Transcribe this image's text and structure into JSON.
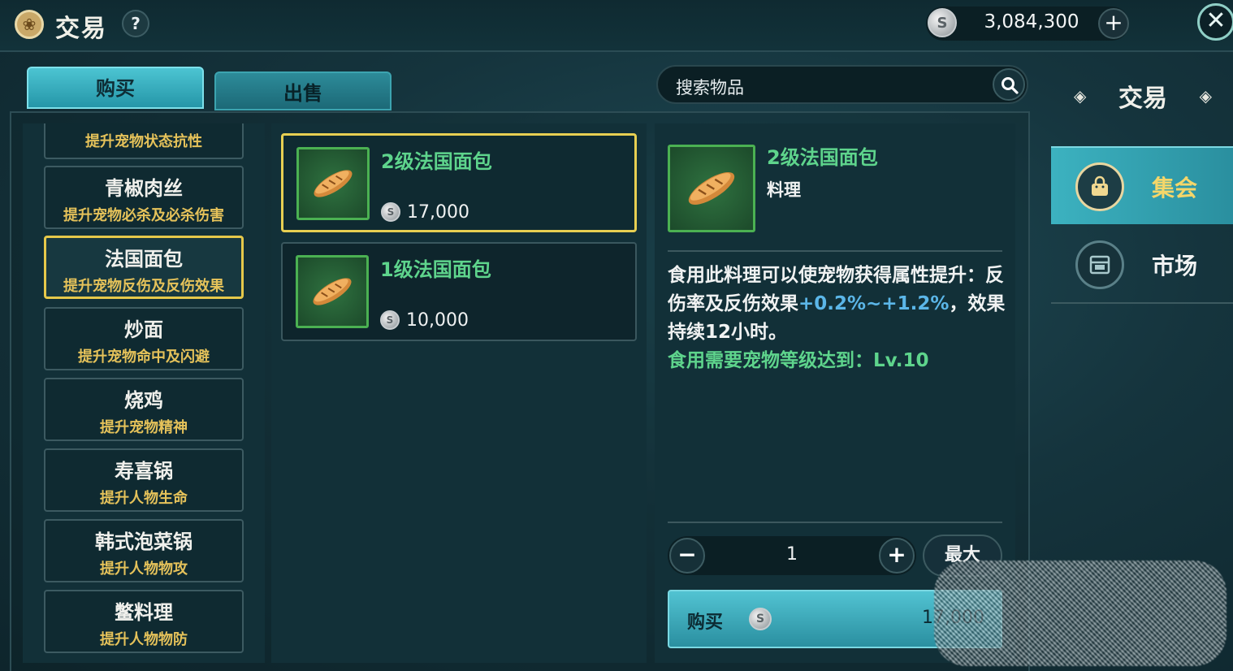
{
  "header": {
    "title": "交易",
    "help_label": "?",
    "currency_value": "3,084,300",
    "add_label": "+",
    "close_label": "✕"
  },
  "tabs": {
    "buy": "购买",
    "sell": "出售"
  },
  "search": {
    "placeholder": "搜索物品"
  },
  "categories": [
    {
      "name": "",
      "desc": "提升宠物状态抗性",
      "partial": true
    },
    {
      "name": "青椒肉丝",
      "desc": "提升宠物必杀及必杀伤害"
    },
    {
      "name": "法国面包",
      "desc": "提升宠物反伤及反伤效果",
      "selected": true
    },
    {
      "name": "炒面",
      "desc": "提升宠物命中及闪避"
    },
    {
      "name": "烧鸡",
      "desc": "提升宠物精神"
    },
    {
      "name": "寿喜锅",
      "desc": "提升人物生命"
    },
    {
      "name": "韩式泡菜锅",
      "desc": "提升人物物攻"
    },
    {
      "name": "鳖料理",
      "desc": "提升人物物防"
    }
  ],
  "products": [
    {
      "name": "2级法国面包",
      "price": "17,000",
      "selected": true
    },
    {
      "name": "1级法国面包",
      "price": "10,000"
    }
  ],
  "detail": {
    "name": "2级法国面包",
    "type": "料理",
    "desc_part1": "食用此料理可以使宠物获得属性提升：反伤率及反伤效果",
    "desc_highlight": "+0.2%~+1.2%",
    "desc_part2": "，效果持续12小时。",
    "requirement": "食用需要宠物等级达到：Lv.10",
    "quantity": "1",
    "minus_label": "−",
    "plus_label": "+",
    "max_label": "最大",
    "buy_label": "购买",
    "buy_price": "17,000"
  },
  "side_nav": {
    "title": "交易",
    "items": [
      {
        "label": "集会",
        "active": true
      },
      {
        "label": "市场"
      }
    ]
  },
  "colors": {
    "accent": "#3cb2c0",
    "gold": "#e5c84a",
    "item_name_green": "#5ed48c",
    "highlight_blue": "#5bb6e8"
  }
}
